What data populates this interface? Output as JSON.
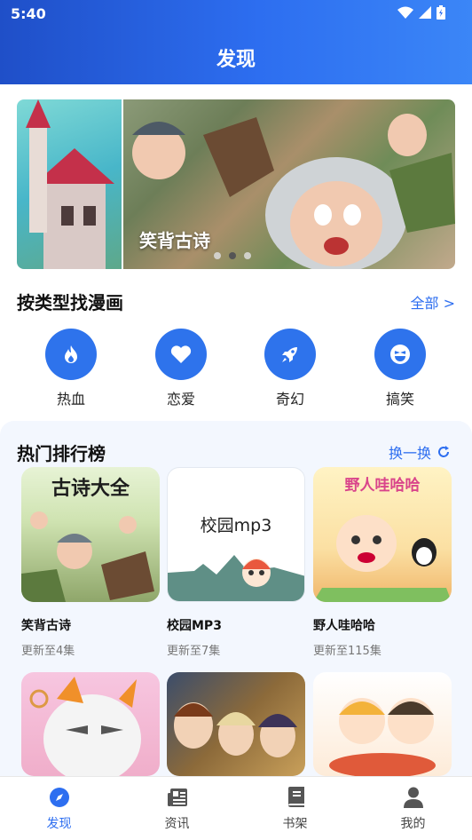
{
  "status": {
    "time": "5:40"
  },
  "header": {
    "title": "发现"
  },
  "banner": {
    "caption": "笑背古诗",
    "page_count": 3,
    "active_index": 1
  },
  "categories": {
    "title": "按类型找漫画",
    "all_link": "全部 >",
    "items": [
      {
        "label": "热血",
        "icon": "flame-icon"
      },
      {
        "label": "恋爱",
        "icon": "heart-icon"
      },
      {
        "label": "奇幻",
        "icon": "rocket-icon"
      },
      {
        "label": "搞笑",
        "icon": "laugh-face-icon"
      }
    ]
  },
  "ranking": {
    "title": "热门排行榜",
    "refresh_label": "换一换",
    "cards": [
      {
        "title": "笑背古诗",
        "subtitle": "更新至4集",
        "cover_text": "古诗大全"
      },
      {
        "title": "校园MP3",
        "subtitle": "更新至7集",
        "cover_text": "校园mp3"
      },
      {
        "title": "野人哇哈哈",
        "subtitle": "更新至115集",
        "cover_text": "野人哇哈哈"
      }
    ]
  },
  "bottom_nav": {
    "items": [
      {
        "label": "发现",
        "icon": "compass-icon",
        "active": true
      },
      {
        "label": "资讯",
        "icon": "news-icon",
        "active": false
      },
      {
        "label": "书架",
        "icon": "book-icon",
        "active": false
      },
      {
        "label": "我的",
        "icon": "person-icon",
        "active": false
      }
    ]
  },
  "colors": {
    "accent": "#2d6ef0",
    "header_start": "#1f4fc8",
    "header_end": "#3b86f7"
  }
}
